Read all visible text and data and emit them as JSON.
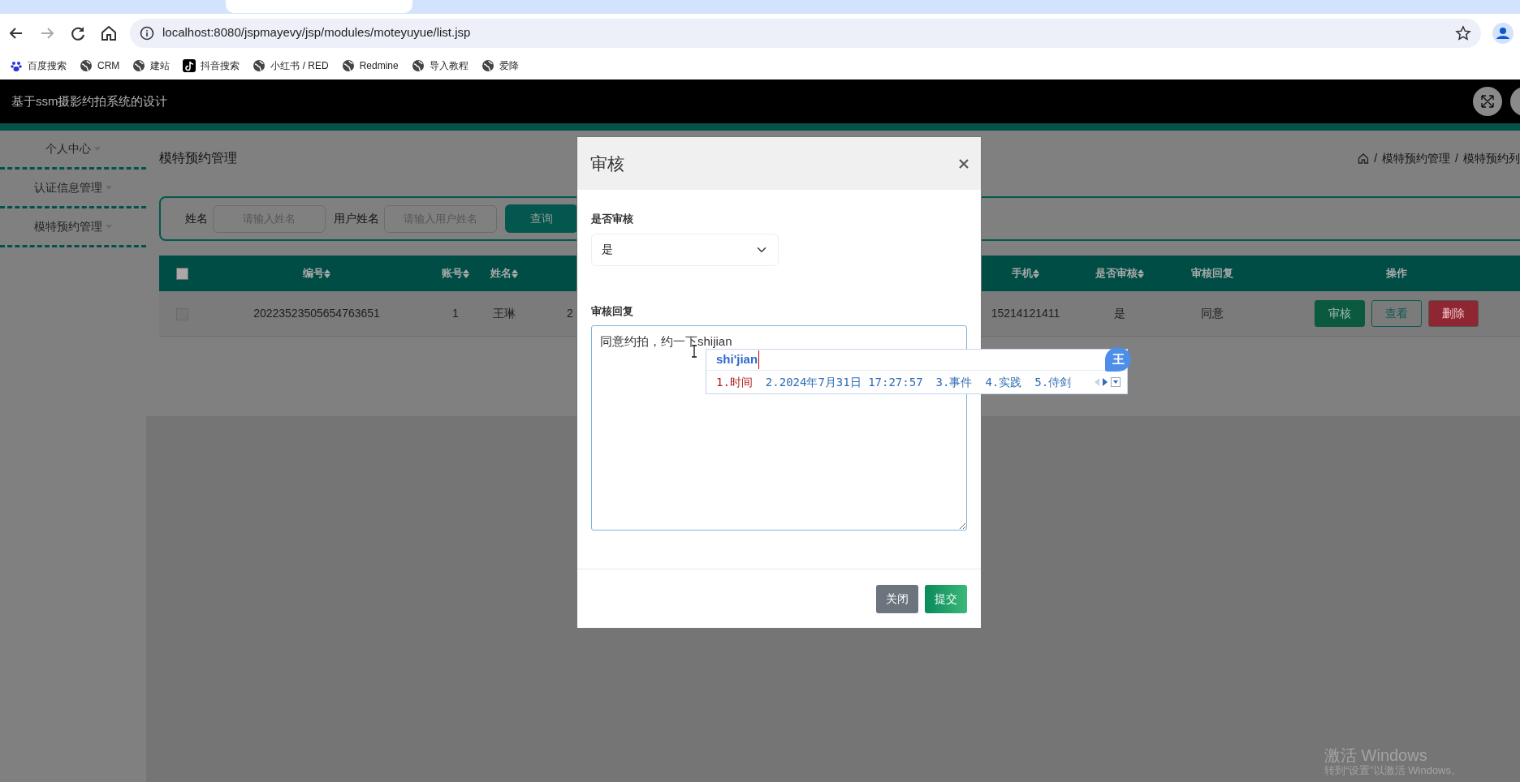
{
  "browser": {
    "url": "localhost:8080/jspmayevy/jsp/modules/moteyuyue/list.jsp",
    "bookmarks": [
      {
        "label": "百度搜索",
        "kind": "paw"
      },
      {
        "label": "CRM",
        "kind": "globe"
      },
      {
        "label": "建站",
        "kind": "globe"
      },
      {
        "label": "抖音搜索",
        "kind": "note"
      },
      {
        "label": "小红书 / RED",
        "kind": "globe"
      },
      {
        "label": "Redmine",
        "kind": "globe"
      },
      {
        "label": "导入教程",
        "kind": "globe"
      },
      {
        "label": "爱降",
        "kind": "globe"
      }
    ]
  },
  "app": {
    "title": "基于ssm摄影约拍系统的设计"
  },
  "sidebar": {
    "items": [
      {
        "label": "个人中心"
      },
      {
        "label": "认证信息管理"
      },
      {
        "label": "模特预约管理"
      }
    ]
  },
  "page": {
    "title": "模特预约管理",
    "breadcrumb": [
      {
        "separator": "/",
        "label": "模特预约管理"
      },
      {
        "separator": "/",
        "label": "模特预约列"
      }
    ]
  },
  "search": {
    "fields": [
      {
        "label": "姓名",
        "placeholder": "请输入姓名"
      },
      {
        "label": "用户姓名",
        "placeholder": "请输入用户姓名"
      }
    ],
    "button": "查询"
  },
  "table": {
    "header_checked": false,
    "columns": [
      {
        "label": "编号",
        "sortable": true
      },
      {
        "label": "账号",
        "sortable": true
      },
      {
        "label": "姓名",
        "sortable": true
      },
      {
        "kind": "covered"
      },
      {
        "label": "手机",
        "sortable": true
      },
      {
        "label": "是否审核",
        "sortable": true
      },
      {
        "label": "审核回复",
        "sortable": false
      },
      {
        "label": "操作",
        "sortable": false
      }
    ],
    "rows": [
      {
        "checked": false,
        "cells": [
          "20223523505654763651",
          "1",
          "王琳",
          "2",
          "15214121411",
          "是",
          "同意"
        ],
        "actions": [
          {
            "label": "审核",
            "kind": "approve"
          },
          {
            "label": "查看",
            "kind": "view"
          },
          {
            "label": "删除",
            "kind": "delete"
          }
        ]
      }
    ]
  },
  "modal": {
    "title": "审核",
    "fields": [
      {
        "kind": "select",
        "label": "是否审核",
        "value": "是"
      },
      {
        "kind": "textarea",
        "label": "审核回复",
        "value": "同意约拍，约一下shijian"
      }
    ],
    "buttons": [
      {
        "label": "关闭",
        "kind": "secondary"
      },
      {
        "label": "提交",
        "kind": "primary"
      }
    ]
  },
  "ime": {
    "composition": "shi'jian",
    "logo": "王",
    "candidates": [
      {
        "label": "1.时间",
        "selected": true
      },
      {
        "label": "2.2024年7月31日 17:27:57",
        "selected": false
      },
      {
        "label": "3.事件",
        "selected": false
      },
      {
        "label": "4.实践",
        "selected": false
      },
      {
        "label": "5.侍剑",
        "selected": false
      }
    ]
  },
  "os_notice": {
    "lines": [
      "激活 Windows",
      "转到“设置”以激活 Windows。"
    ]
  }
}
